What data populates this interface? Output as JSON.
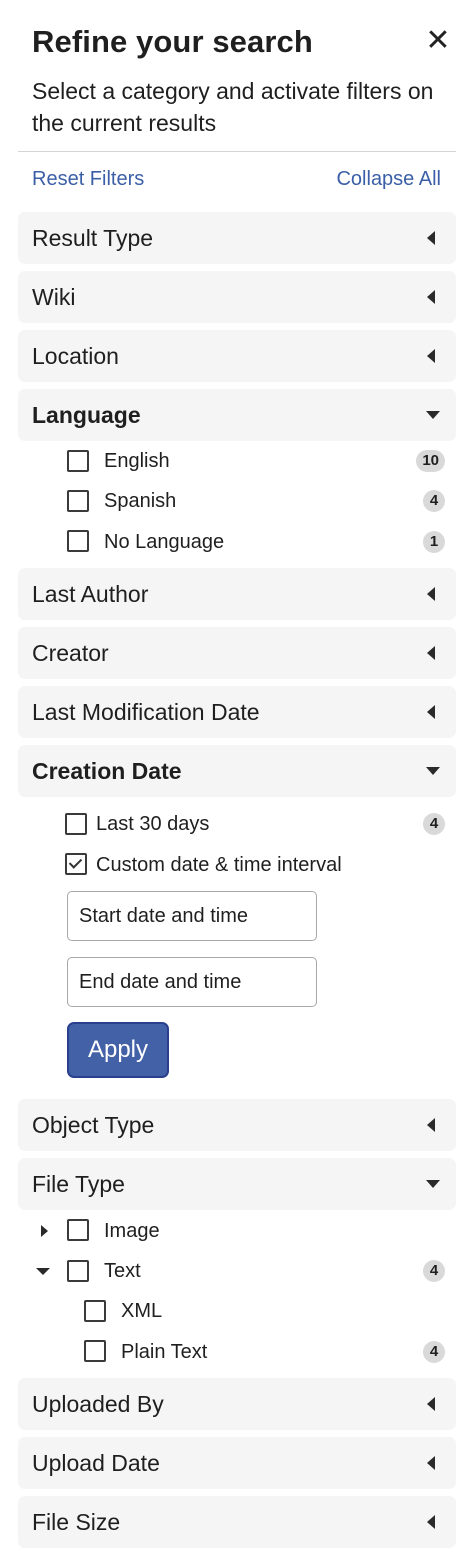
{
  "header": {
    "title": "Refine your search",
    "close_glyph": "✕",
    "subtitle": "Select a category and activate filters on the current results"
  },
  "actions": {
    "reset": "Reset Filters",
    "collapse": "Collapse All"
  },
  "categories": {
    "result_type": "Result Type",
    "wiki": "Wiki",
    "location": "Location",
    "language": "Language",
    "last_author": "Last Author",
    "creator": "Creator",
    "last_modification_date": "Last Modification Date",
    "creation_date": "Creation Date",
    "object_type": "Object Type",
    "file_type": "File Type",
    "uploaded_by": "Uploaded By",
    "upload_date": "Upload Date",
    "file_size": "File Size"
  },
  "language_options": [
    {
      "label": "English",
      "count": "10",
      "checked": false
    },
    {
      "label": "Spanish",
      "count": "4",
      "checked": false
    },
    {
      "label": "No Language",
      "count": "1",
      "checked": false
    }
  ],
  "creation_date_options": {
    "last30": {
      "label": "Last 30 days",
      "count": "4",
      "checked": false
    },
    "custom": {
      "label": "Custom date & time interval",
      "checked": true
    },
    "start_placeholder": "Start date and time",
    "end_placeholder": "End date and time",
    "apply_label": "Apply"
  },
  "file_type_options": {
    "image": {
      "label": "Image",
      "expanded": false,
      "checked": false
    },
    "text": {
      "label": "Text",
      "count": "4",
      "expanded": true,
      "checked": false
    },
    "xml": {
      "label": "XML",
      "checked": false
    },
    "plain_text": {
      "label": "Plain Text",
      "count": "4",
      "checked": false
    }
  },
  "icons": {
    "collapsed": "caret-left-icon",
    "expanded": "caret-down-icon",
    "tree_collapsed": "caret-right-icon",
    "close": "close-icon"
  },
  "colors": {
    "link": "#3b5fa7",
    "apply_bg": "#4361a6",
    "category_bg": "#f5f5f5",
    "badge_bg": "#d9d9d9"
  }
}
